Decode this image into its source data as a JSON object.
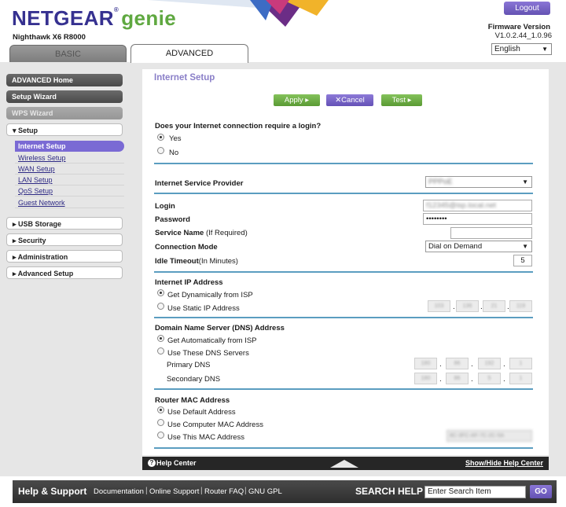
{
  "header": {
    "logo_brand": "NETGEAR",
    "logo_reg": "®",
    "logo_product": "genie",
    "model": "Nighthawk X6 R8000",
    "logout_label": "Logout",
    "firmware_label": "Firmware Version",
    "firmware_version": "V1.0.2.44_1.0.96",
    "language": "English"
  },
  "tabs": {
    "basic": "BASIC",
    "advanced": "ADVANCED"
  },
  "sidebar": {
    "advanced_home": "ADVANCED Home",
    "setup_wizard": "Setup Wizard",
    "wps_wizard": "WPS Wizard",
    "setup": "▾ Setup",
    "setup_items": [
      "Internet Setup",
      "Wireless Setup",
      "WAN Setup",
      "LAN Setup",
      "QoS Setup",
      "Guest Network"
    ],
    "usb_storage": "▸ USB Storage",
    "security": "▸ Security",
    "administration": "▸ Administration",
    "advanced_setup": "▸ Advanced Setup"
  },
  "page": {
    "title": "Internet Setup",
    "apply_label": "Apply ▸",
    "cancel_label": "✕Cancel",
    "test_label": "Test ▸",
    "login_question": "Does your Internet connection require a login?",
    "yes_label": "Yes",
    "no_label": "No",
    "isp_label": "Internet Service Provider",
    "isp_value": "PPPoE",
    "login_label": "Login",
    "login_value": "f12345@isp.local.net",
    "password_label": "Password",
    "password_value": "••••••••",
    "service_name_label": "Service Name",
    "service_name_hint": "(If Required)",
    "connection_mode_label": "Connection Mode",
    "connection_mode_value": "Dial on Demand",
    "idle_timeout_label": "Idle Timeout",
    "idle_timeout_hint": "(In Minutes)",
    "idle_timeout_value": "5",
    "internet_ip_heading": "Internet IP Address",
    "get_dynamic_label": "Get Dynamically from ISP",
    "use_static_label": "Use Static IP Address",
    "static_ip_octets": [
      "103",
      "136",
      "21",
      "119"
    ],
    "dns_heading": "Domain Name Server (DNS) Address",
    "dns_auto_label": "Get Automatically from ISP",
    "dns_manual_label": "Use These DNS Servers",
    "primary_dns_label": "Primary DNS",
    "primary_dns_octets": [
      "180",
      "86",
      "192",
      "1"
    ],
    "secondary_dns_label": "Secondary DNS",
    "secondary_dns_octets": [
      "180",
      "86",
      "5",
      "1"
    ],
    "mac_heading": "Router MAC Address",
    "mac_default_label": "Use Default Address",
    "mac_computer_label": "Use Computer MAC Address",
    "mac_this_label": "Use This MAC Address",
    "mac_value": "8C-3FC-AF-7C-2C-5A"
  },
  "help": {
    "help_center": "Help Center",
    "show_hide": "Show/Hide Help Center"
  },
  "footer": {
    "help_support": "Help & Support",
    "links": [
      "Documentation",
      "Online Support",
      "Router FAQ",
      "GNU GPL"
    ],
    "search_label": "SEARCH HELP",
    "search_placeholder": "Enter Search Item",
    "go_label": "GO"
  },
  "colors": {
    "brand": "#363190",
    "accent_purple": "#7a6ad4",
    "accent_green": "#5fa840",
    "divider_blue": "#5b9dc0"
  }
}
